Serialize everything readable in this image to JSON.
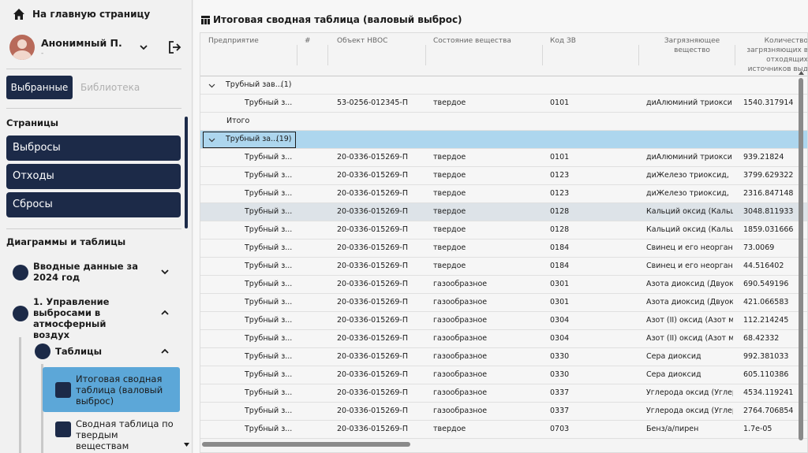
{
  "sidebar": {
    "home_label": "На главную страницу",
    "user": {
      "name": "Анонимный П.",
      "subtitle": "-"
    },
    "tabs": {
      "favorites": "Выбранные",
      "library": "Библиотека"
    },
    "pages_title": "Страницы",
    "pages": [
      "Выбросы",
      "Отходы",
      "Сбросы"
    ],
    "diagrams_title": "Диаграммы и таблицы",
    "tree": {
      "node1": "Вводные данные за 2024 год",
      "node2": "1. Управление выбросами в атмосферный воздух",
      "node3": "Таблицы",
      "leaf1": "Итоговая сводная таблица (валовый выброс)",
      "leaf2": "Сводная таблица по твердым веществам"
    }
  },
  "main": {
    "title": "Итоговая сводная таблица (валовый выброс)",
    "columns": {
      "enterprise": "Предприятие",
      "num": "#",
      "object": "Объект НВОС",
      "state": "Состояние вещества",
      "code": "Код ЗВ",
      "pollutant": "Загрязняющее вещество",
      "qty": "Количество загрязняющих в отходящих источников выд"
    },
    "group1": {
      "label": "Трубный зав...",
      "count": "(1)"
    },
    "group1_rows": [
      [
        "Трубный з...",
        "53-0256-012345-П",
        "твердое",
        "0101",
        "диАлюминий триокси",
        "1540.317914"
      ]
    ],
    "total_label": "Итого",
    "group2": {
      "label": "Трубный за...",
      "count": "(19)"
    },
    "group2_rows": [
      [
        "Трубный з...",
        "20-0336-015269-П",
        "твердое",
        "0101",
        "диАлюминий триокси",
        "939.21824"
      ],
      [
        "Трубный з...",
        "20-0336-015269-П",
        "твердое",
        "0123",
        "диЖелезо триоксид,",
        "3799.629322"
      ],
      [
        "Трубный з...",
        "20-0336-015269-П",
        "твердое",
        "0123",
        "диЖелезо триоксид,",
        "2316.847148"
      ],
      [
        "Трубный з...",
        "20-0336-015269-П",
        "твердое",
        "0128",
        "Кальций оксид (Кальц",
        "3048.811933"
      ],
      [
        "Трубный з...",
        "20-0336-015269-П",
        "твердое",
        "0128",
        "Кальций оксид (Кальц",
        "1859.031666"
      ],
      [
        "Трубный з...",
        "20-0336-015269-П",
        "твердое",
        "0184",
        "Свинец и его неорган",
        "73.0069"
      ],
      [
        "Трубный з...",
        "20-0336-015269-П",
        "твердое",
        "0184",
        "Свинец и его неорган",
        "44.516402"
      ],
      [
        "Трубный з...",
        "20-0336-015269-П",
        "газообразное",
        "0301",
        "Азота диоксид (Двуок",
        "690.549196"
      ],
      [
        "Трубный з...",
        "20-0336-015269-П",
        "газообразное",
        "0301",
        "Азота диоксид (Двуок",
        "421.066583"
      ],
      [
        "Трубный з...",
        "20-0336-015269-П",
        "газообразное",
        "0304",
        "Азот (II) оксид (Азот м",
        "112.214245"
      ],
      [
        "Трубный з...",
        "20-0336-015269-П",
        "газообразное",
        "0304",
        "Азот (II) оксид (Азот м",
        "68.42332"
      ],
      [
        "Трубный з...",
        "20-0336-015269-П",
        "газообразное",
        "0330",
        "Сера диоксид",
        "992.381033"
      ],
      [
        "Трубный з...",
        "20-0336-015269-П",
        "газообразное",
        "0330",
        "Сера диоксид",
        "605.110386"
      ],
      [
        "Трубный з...",
        "20-0336-015269-П",
        "газообразное",
        "0337",
        "Углерода оксид (Углер",
        "4534.119241"
      ],
      [
        "Трубный з...",
        "20-0336-015269-П",
        "газообразное",
        "0337",
        "Углерода оксид (Углер",
        "2764.706854"
      ],
      [
        "Трубный з...",
        "20-0336-015269-П",
        "твердое",
        "0703",
        "Бенз/а/пирен",
        "1.7e-05"
      ]
    ]
  }
}
